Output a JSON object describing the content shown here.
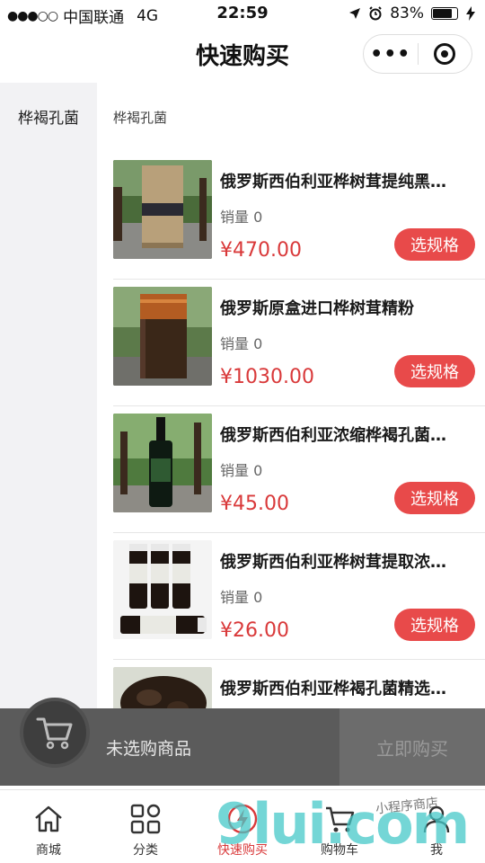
{
  "status_bar": {
    "signal": "●●●○○",
    "carrier": "中国联通",
    "network": "4G",
    "time": "22:59",
    "battery_text": "83%",
    "battery_level": 0.83
  },
  "nav": {
    "title": "快速购买",
    "more_label": "•••"
  },
  "sidebar": {
    "items": [
      {
        "label": "桦褐孔菌",
        "active": true
      }
    ]
  },
  "main": {
    "section_title": "桦褐孔菌",
    "products": [
      {
        "name": "俄罗斯西伯利亚桦树茸提纯黑…",
        "sales": "销量 0",
        "price": "¥470.00",
        "button": "选规格",
        "image": "tea-box-outdoor"
      },
      {
        "name": "俄罗斯原盒进口桦树茸精粉",
        "sales": "销量 0",
        "price": "¥1030.00",
        "button": "选规格",
        "image": "powder-jar-copper-lid"
      },
      {
        "name": "俄罗斯西伯利亚浓缩桦褐孔菌…",
        "sales": "销量 0",
        "price": "¥45.00",
        "button": "选规格",
        "image": "dark-bottle-outdoor"
      },
      {
        "name": "俄罗斯西伯利亚桦树茸提取浓…",
        "sales": "销量 0",
        "price": "¥26.00",
        "button": "选规格",
        "image": "four-small-bottles"
      },
      {
        "name": "俄罗斯西伯利亚桦褐孔菌精选…",
        "sales": "",
        "price": "",
        "button": "",
        "image": "chaga-chunks"
      }
    ]
  },
  "cart": {
    "empty_text": "未选购商品",
    "buy_label": "立即购买"
  },
  "tabs": [
    {
      "label": "商城",
      "icon": "home-icon"
    },
    {
      "label": "分类",
      "icon": "grid-icon"
    },
    {
      "label": "快速购买",
      "icon": "lightning-icon"
    },
    {
      "label": "购物车",
      "icon": "cart-icon"
    },
    {
      "label": "我",
      "icon": "user-icon"
    }
  ],
  "watermark": {
    "main": "9lui.com",
    "sub": "小程序商店"
  },
  "colors": {
    "accent_red": "#e84a4a",
    "price_red": "#d9393a",
    "cart_bar": "#5b5b5b",
    "sidebar_bg": "#f2f2f4"
  }
}
